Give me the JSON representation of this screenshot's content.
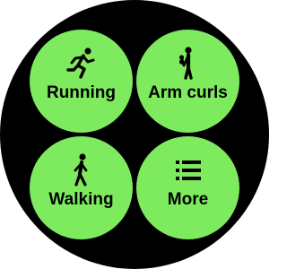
{
  "colors": {
    "background": "#000000",
    "tile": "#7EEB5F",
    "ink": "#000000"
  },
  "tiles": [
    {
      "label": "Running",
      "icon": "running-icon"
    },
    {
      "label": "Arm curls",
      "icon": "arm-curls-icon"
    },
    {
      "label": "Walking",
      "icon": "walking-icon"
    },
    {
      "label": "More",
      "icon": "list-icon"
    }
  ]
}
